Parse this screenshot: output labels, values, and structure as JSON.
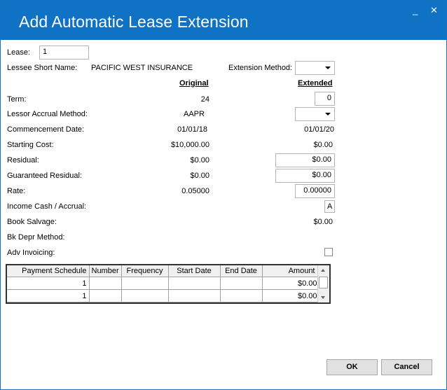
{
  "window": {
    "title": "Add Automatic Lease Extension",
    "minimize_glyph": "_",
    "close_glyph": "✕"
  },
  "lease": {
    "label": "Lease:",
    "value": "1"
  },
  "lessee": {
    "label": "Lessee Short Name:",
    "value": "PACIFIC WEST INSURANCE"
  },
  "extension_method": {
    "label": "Extension Method:",
    "value": ""
  },
  "headers": {
    "original": "Original",
    "extended": "Extended"
  },
  "rows": {
    "term": {
      "label": "Term:",
      "original": "24",
      "extended": "0"
    },
    "lessor_accrual": {
      "label": "Lessor Accrual Method:",
      "original": "AAPR",
      "extended": ""
    },
    "commencement": {
      "label": "Commencement Date:",
      "original": "01/01/18",
      "extended": "01/01/20"
    },
    "starting_cost": {
      "label": "Starting Cost:",
      "original": "$10,000.00",
      "extended": "$0.00"
    },
    "residual": {
      "label": "Residual:",
      "original": "$0.00",
      "extended": "$0.00"
    },
    "guaranteed_residual": {
      "label": "Guaranteed Residual:",
      "original": "$0.00",
      "extended": "$0.00"
    },
    "rate": {
      "label": "Rate:",
      "original": "0.05000",
      "extended": "0.00000"
    },
    "income_cash": {
      "label": "Income Cash / Accrual:",
      "extended": "A"
    },
    "book_salvage": {
      "label": "Book Salvage:",
      "extended": "$0.00"
    },
    "bk_depr": {
      "label": "Bk Depr Method:"
    },
    "adv_invoicing": {
      "label": "Adv Invoicing:",
      "checked": false
    }
  },
  "payment_table": {
    "columns": [
      "Payment Schedule",
      "Number",
      "Frequency",
      "Start Date",
      "End Date",
      "Amount"
    ],
    "rows": [
      [
        "1",
        "",
        "",
        "",
        "",
        "$0.00"
      ],
      [
        "1",
        "",
        "",
        "",
        "",
        "$0.00"
      ]
    ]
  },
  "buttons": {
    "ok": "OK",
    "cancel": "Cancel"
  }
}
